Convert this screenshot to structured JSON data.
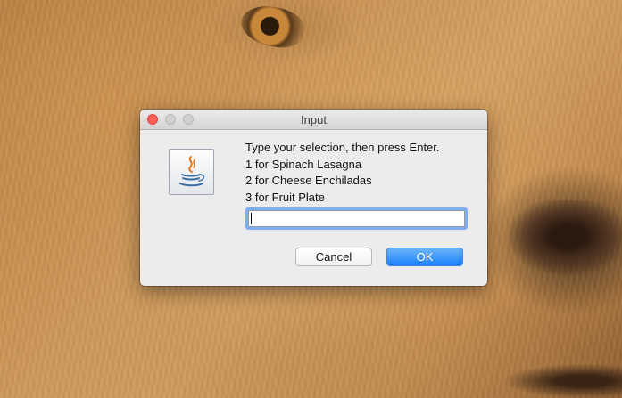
{
  "dialog": {
    "title": "Input",
    "message_lines": [
      "Type your selection, then press Enter.",
      "1 for Spinach Lasagna",
      "2 for Cheese Enchiladas",
      "3 for Fruit Plate"
    ],
    "input_value": "",
    "cancel_label": "Cancel",
    "ok_label": "OK",
    "icon": "java-icon"
  },
  "colors": {
    "close_button": "#fc5f57",
    "ok_button": "#1a82fb",
    "focus_ring": "#7eadf6"
  }
}
